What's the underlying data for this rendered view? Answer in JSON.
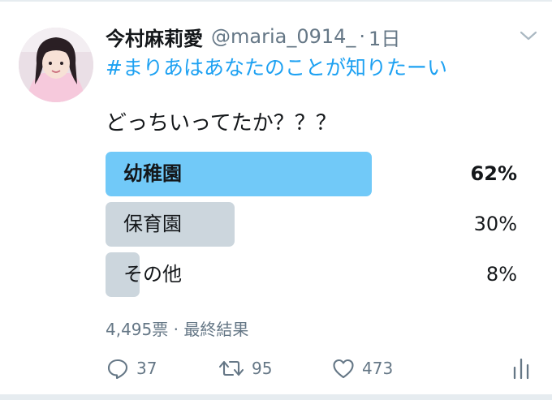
{
  "tweet": {
    "display_name": "今村麻莉愛",
    "handle": "@maria_0914_",
    "separator": "·",
    "timestamp": "1日",
    "hashtag": "#まりあはあなたのことが知りたーい",
    "text": "どっちいってたか？？？"
  },
  "poll": {
    "options": [
      {
        "label": "幼稚園",
        "percent_text": "62%",
        "percent": 62,
        "leading": true
      },
      {
        "label": "保育園",
        "percent_text": "30%",
        "percent": 30,
        "leading": false
      },
      {
        "label": "その他",
        "percent_text": "8%",
        "percent": 8,
        "leading": false
      }
    ],
    "meta": "4,495票 · 最終結果"
  },
  "actions": {
    "replies": "37",
    "retweets": "95",
    "likes": "473"
  },
  "colors": {
    "accent": "#1da1f2",
    "leading_bar": "#71c9f8",
    "other_bar": "#ccd6dd",
    "secondary_text": "#657786"
  },
  "icons": {
    "more": "chevron-down-icon",
    "reply": "reply-icon",
    "retweet": "retweet-icon",
    "like": "heart-icon",
    "analytics": "analytics-icon"
  }
}
